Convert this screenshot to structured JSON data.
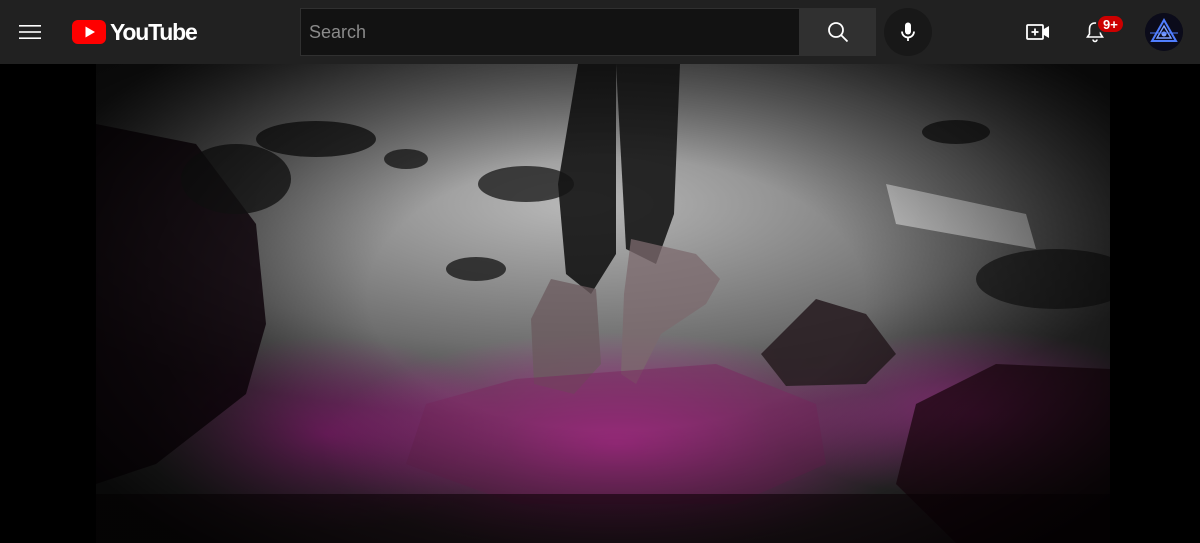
{
  "masthead": {
    "logo_text": "YouTube",
    "search_placeholder": "Search",
    "notification_count": "9+"
  },
  "icons": {
    "menu": "hamburger-menu-icon",
    "logo": "youtube-play-icon",
    "search": "magnifier-icon",
    "mic": "microphone-icon",
    "create": "video-camera-plus-icon",
    "notifications": "bell-icon"
  },
  "colors": {
    "masthead_bg": "#212121",
    "brand_red": "#ff0000",
    "badge_red": "#cc0000",
    "search_bg": "#121212",
    "search_button_bg": "#303030"
  }
}
